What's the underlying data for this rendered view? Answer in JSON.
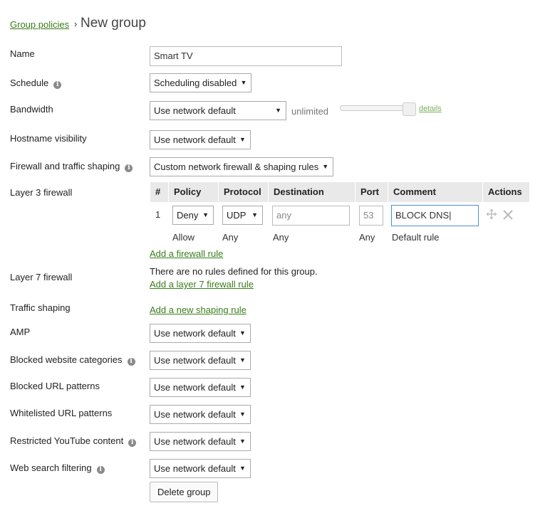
{
  "breadcrumb": {
    "parent": "Group policies",
    "separator": "›",
    "current": "New group"
  },
  "fields": {
    "name": {
      "label": "Name",
      "value": "Smart TV"
    },
    "schedule": {
      "label": "Schedule",
      "value": "Scheduling disabled"
    },
    "bandwidth": {
      "label": "Bandwidth",
      "value": "Use network default",
      "limit_text": "unlimited",
      "details_link": "details"
    },
    "hostname": {
      "label": "Hostname visibility",
      "value": "Use network default"
    },
    "firewall": {
      "label": "Firewall and traffic shaping",
      "value": "Custom network firewall & shaping rules"
    },
    "l3": {
      "label": "Layer 3 firewall"
    },
    "l7": {
      "label": "Layer 7 firewall",
      "empty_text": "There are no rules defined for this group.",
      "add_link": "Add a layer 7 firewall rule"
    },
    "shaping": {
      "label": "Traffic shaping",
      "add_link": "Add a new shaping rule"
    },
    "amp": {
      "label": "AMP",
      "value": "Use network default"
    },
    "blocked_categories": {
      "label": "Blocked website categories",
      "value": "Use network default"
    },
    "blocked_urls": {
      "label": "Blocked URL patterns",
      "value": "Use network default"
    },
    "whitelisted_urls": {
      "label": "Whitelisted URL patterns",
      "value": "Use network default"
    },
    "youtube": {
      "label": "Restricted YouTube content",
      "value": "Use network default"
    },
    "web_search": {
      "label": "Web search filtering",
      "value": "Use network default"
    }
  },
  "firewall_table": {
    "headers": [
      "#",
      "Policy",
      "Protocol",
      "Destination",
      "Port",
      "Comment",
      "Actions"
    ],
    "rule": {
      "number": "1",
      "policy": "Deny",
      "protocol": "UDP",
      "destination": "any",
      "port": "53",
      "comment": "BLOCK DNS|"
    },
    "default_rule": {
      "policy": "Allow",
      "protocol": "Any",
      "destination": "Any",
      "port": "Any",
      "comment": "Default rule"
    },
    "add_link": "Add a firewall rule"
  },
  "actions": {
    "delete_label": "Delete group"
  },
  "icons": {
    "info": "info-icon",
    "move": "move-icon",
    "delete": "close-icon",
    "caret": "caret-down-icon"
  },
  "colors": {
    "link": "#3a7d1a",
    "header_bg": "#e9e9e9",
    "focus_border": "#4a90d9"
  }
}
